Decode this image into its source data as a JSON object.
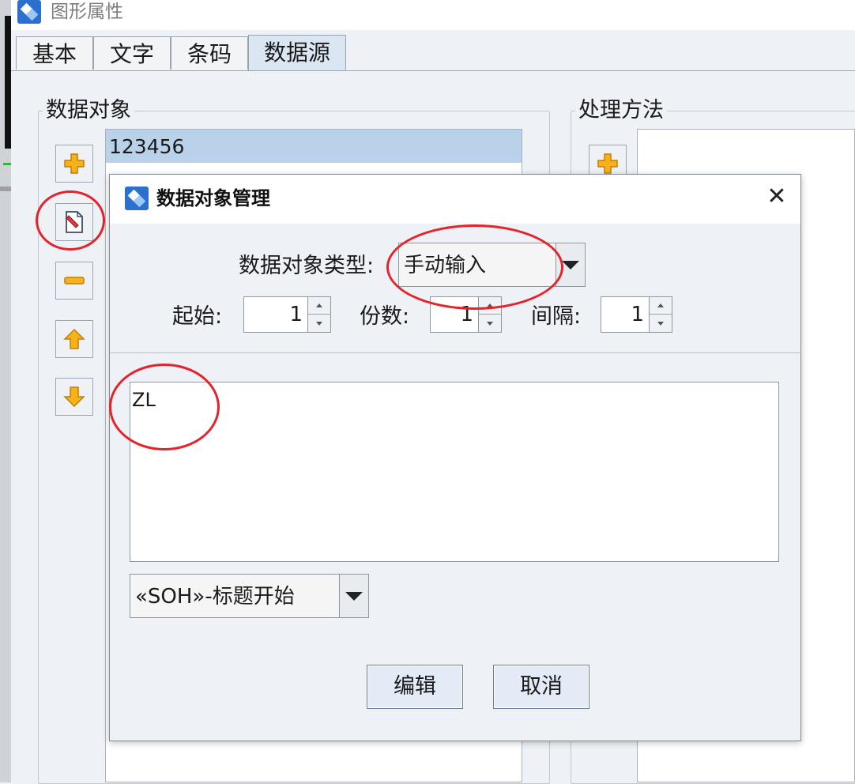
{
  "window": {
    "title": "图形属性",
    "tabs": [
      "基本",
      "文字",
      "条码",
      "数据源"
    ],
    "active_tab": "数据源"
  },
  "data_objects": {
    "group_label": "数据对象",
    "items": [
      "123456"
    ],
    "buttons": [
      "add-icon",
      "edit-icon",
      "remove-icon",
      "move-up-icon",
      "move-down-icon"
    ]
  },
  "processing": {
    "group_label": "处理方法",
    "buttons": [
      "add-icon"
    ]
  },
  "dialog": {
    "title": "数据对象管理",
    "close_glyph": "✕",
    "type_label": "数据对象类型:",
    "type_value": "手动输入",
    "start_label": "起始:",
    "start_value": "1",
    "copies_label": "份数:",
    "copies_value": "1",
    "interval_label": "间隔:",
    "interval_value": "1",
    "content_value": "ZL",
    "control_char_value": "«SOH»-标题开始",
    "edit_button": "编辑",
    "cancel_button": "取消"
  },
  "colors": {
    "accent_tab": "#dbe6f3",
    "selection": "#b9d2ea",
    "annotation_red": "#e5232b",
    "icon_yellow": "#f5b21b"
  }
}
